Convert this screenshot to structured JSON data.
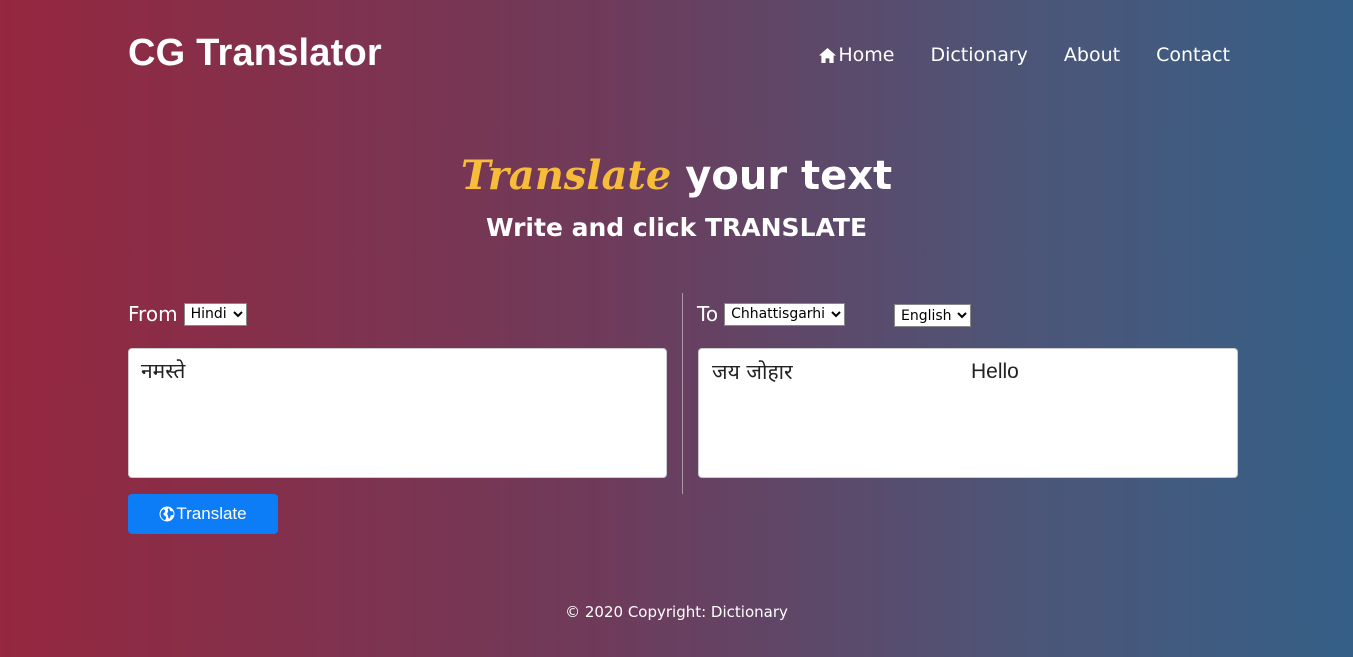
{
  "brand": "CG Translator",
  "nav": {
    "home": "Home",
    "dictionary": "Dictionary",
    "about": "About",
    "contact": "Contact"
  },
  "heading": {
    "accent": "Translate",
    "rest": " your text"
  },
  "subheading": {
    "prefix": "Write and click ",
    "strong": "TRANSLATE"
  },
  "from": {
    "label": "From",
    "selected": "Hindi"
  },
  "to": {
    "label": "To",
    "selected": "Chhattisgarhi"
  },
  "target_language": {
    "selected": "English"
  },
  "input_text": "नमस्ते",
  "output": {
    "chhattisgarhi": "जय जोहार",
    "english": "Hello"
  },
  "translate_button": "Translate",
  "footer": "© 2020 Copyright: Dictionary",
  "colors": {
    "accent": "#f7bd3a",
    "button": "#0d7cf7",
    "gradient_left": "#95273f",
    "gradient_right": "#355f87"
  },
  "icons": {
    "home": "home-icon",
    "translate": "globe-icon"
  }
}
